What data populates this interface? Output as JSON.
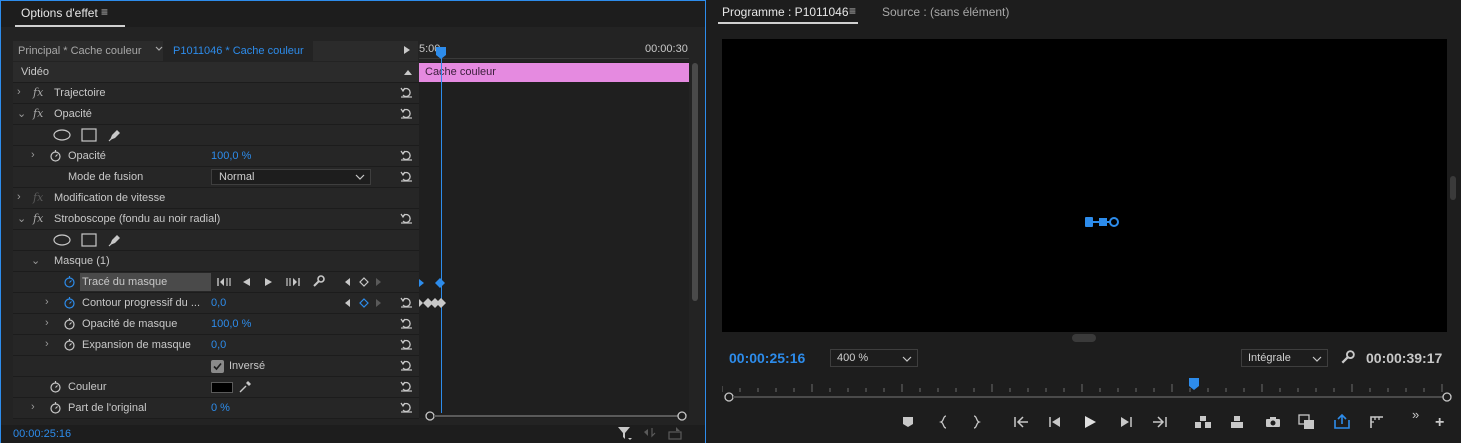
{
  "effect_panel": {
    "title": "Options d'effet",
    "master_clip": "Principal * Cache couleur",
    "sequence_clip": "P1011046 * Cache couleur",
    "ruler_start": "5:00",
    "ruler_end": "00:00:30",
    "section_video": "Vidéo",
    "clip_name": "Cache couleur",
    "rows": {
      "trajectoire": "Trajectoire",
      "opacite_group": "Opacité",
      "opacite_prop": "Opacité",
      "opacite_value": "100,0 %",
      "mode_fusion": "Mode de fusion",
      "mode_fusion_value": "Normal",
      "modif_vitesse": "Modification de vitesse",
      "stroboscope": "Stroboscope (fondu au noir radial)",
      "masque": "Masque (1)",
      "trace_masque": "Tracé du masque",
      "contour": "Contour progressif du ...",
      "contour_value": "0,0",
      "opacite_masque": "Opacité de masque",
      "opacite_masque_value": "100,0 %",
      "expansion": "Expansion de masque",
      "expansion_value": "0,0",
      "inverse": "Inversé",
      "couleur": "Couleur",
      "part_original": "Part de l'original",
      "part_original_value": "0 %"
    },
    "timecode": "00:00:25:16"
  },
  "program_panel": {
    "tab_program": "Programme : P1011046",
    "tab_source": "Source : (sans élément)",
    "timecode_current": "00:00:25:16",
    "zoom": "400 %",
    "resolution": "Intégrale",
    "timecode_duration": "00:00:39:17"
  },
  "colors": {
    "accent": "#2d8ceb",
    "clip": "#e58ae0",
    "panel_bg": "#232323"
  }
}
